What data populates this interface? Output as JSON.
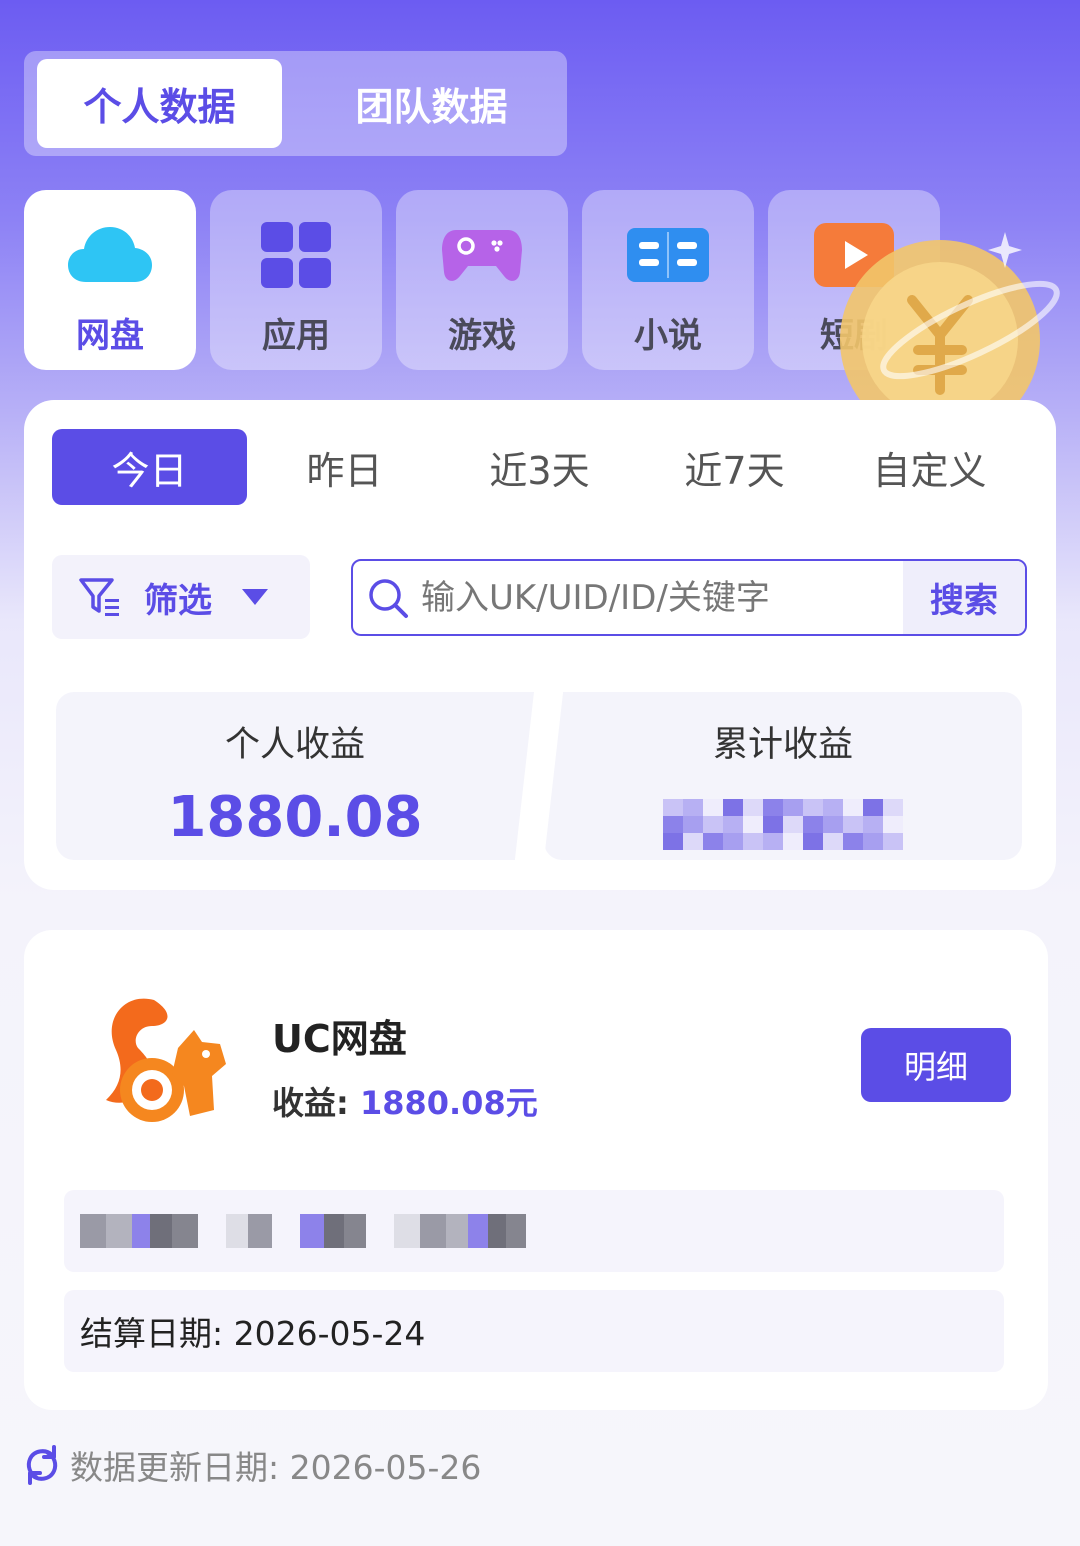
{
  "top_tabs": {
    "personal": "个人数据",
    "team": "团队数据"
  },
  "categories": [
    {
      "label": "网盘",
      "icon": "cloud-icon"
    },
    {
      "label": "应用",
      "icon": "apps-grid-icon"
    },
    {
      "label": "游戏",
      "icon": "gamepad-icon"
    },
    {
      "label": "小说",
      "icon": "book-icon"
    },
    {
      "label": "短剧",
      "icon": "play-icon"
    }
  ],
  "date_tabs": [
    "今日",
    "昨日",
    "近3天",
    "近7天",
    "自定义"
  ],
  "filter": {
    "label": "筛选"
  },
  "search": {
    "placeholder": "输入UK/UID/ID/关键字",
    "button": "搜索"
  },
  "stats": {
    "personal_label": "个人收益",
    "personal_value": "1880.08",
    "total_label": "累计收益"
  },
  "product": {
    "name": "UC网盘",
    "income_label": "收益: ",
    "income_value": "1880.08元",
    "detail_button": "明细",
    "settle_date": "结算日期:  2026-05-24",
    "logo": "uc-squirrel-logo"
  },
  "footer": {
    "update_text": "数据更新日期:  2026-05-26"
  },
  "colors": {
    "accent": "#5b4de6",
    "header_top": "#6c5cf2"
  }
}
